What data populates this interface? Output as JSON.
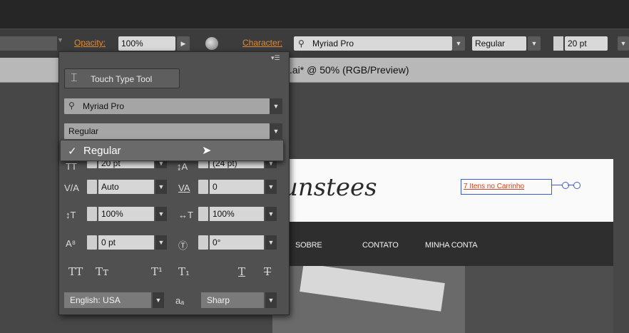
{
  "control_bar": {
    "opacity_label": "Opacity:",
    "opacity_value": "100%",
    "character_label": "Character:",
    "font_value": "Myriad Pro",
    "style_value": "Regular",
    "size_value": "20 pt"
  },
  "document_tab": {
    "title": ".ai* @ 50% (RGB/Preview)"
  },
  "character_panel": {
    "touch_type_label": "Touch Type Tool",
    "font_family": "Myriad Pro",
    "font_style": "Regular",
    "dropdown_option": "Regular",
    "size_value": "20 pt",
    "leading_value": "(24 pt)",
    "kerning_value": "Auto",
    "tracking_value": "0",
    "vscale_value": "100%",
    "hscale_value": "100%",
    "baseline_value": "0 pt",
    "rotation_value": "0°",
    "language_value": "English: USA",
    "antialias_value": "Sharp",
    "antialias_icon_text": "aₐ"
  },
  "website": {
    "logo_text": "unstees",
    "cart_text": "7 Itens no Carrinho",
    "nav_items": [
      "SOBRE",
      "CONTATO",
      "MINHA CONTA"
    ]
  },
  "colors": {
    "accent_orange": "#e48a2d",
    "panel_bg": "#505050"
  }
}
